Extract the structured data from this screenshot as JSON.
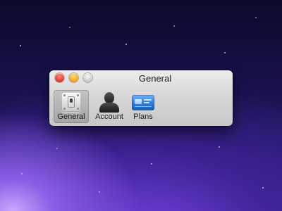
{
  "window": {
    "title": "General"
  },
  "toolbar": {
    "items": [
      {
        "label": "General",
        "icon": "general-switch-icon",
        "selected": true
      },
      {
        "label": "Account",
        "icon": "account-silhouette-icon",
        "selected": false
      },
      {
        "label": "Plans",
        "icon": "plans-card-icon",
        "selected": false
      }
    ]
  },
  "colors": {
    "close": "#e3453b",
    "minimize": "#f5a623",
    "zoom": "#cfcfcf",
    "plans_blue": "#2b7cd9",
    "desktop": "#2d1c78"
  }
}
